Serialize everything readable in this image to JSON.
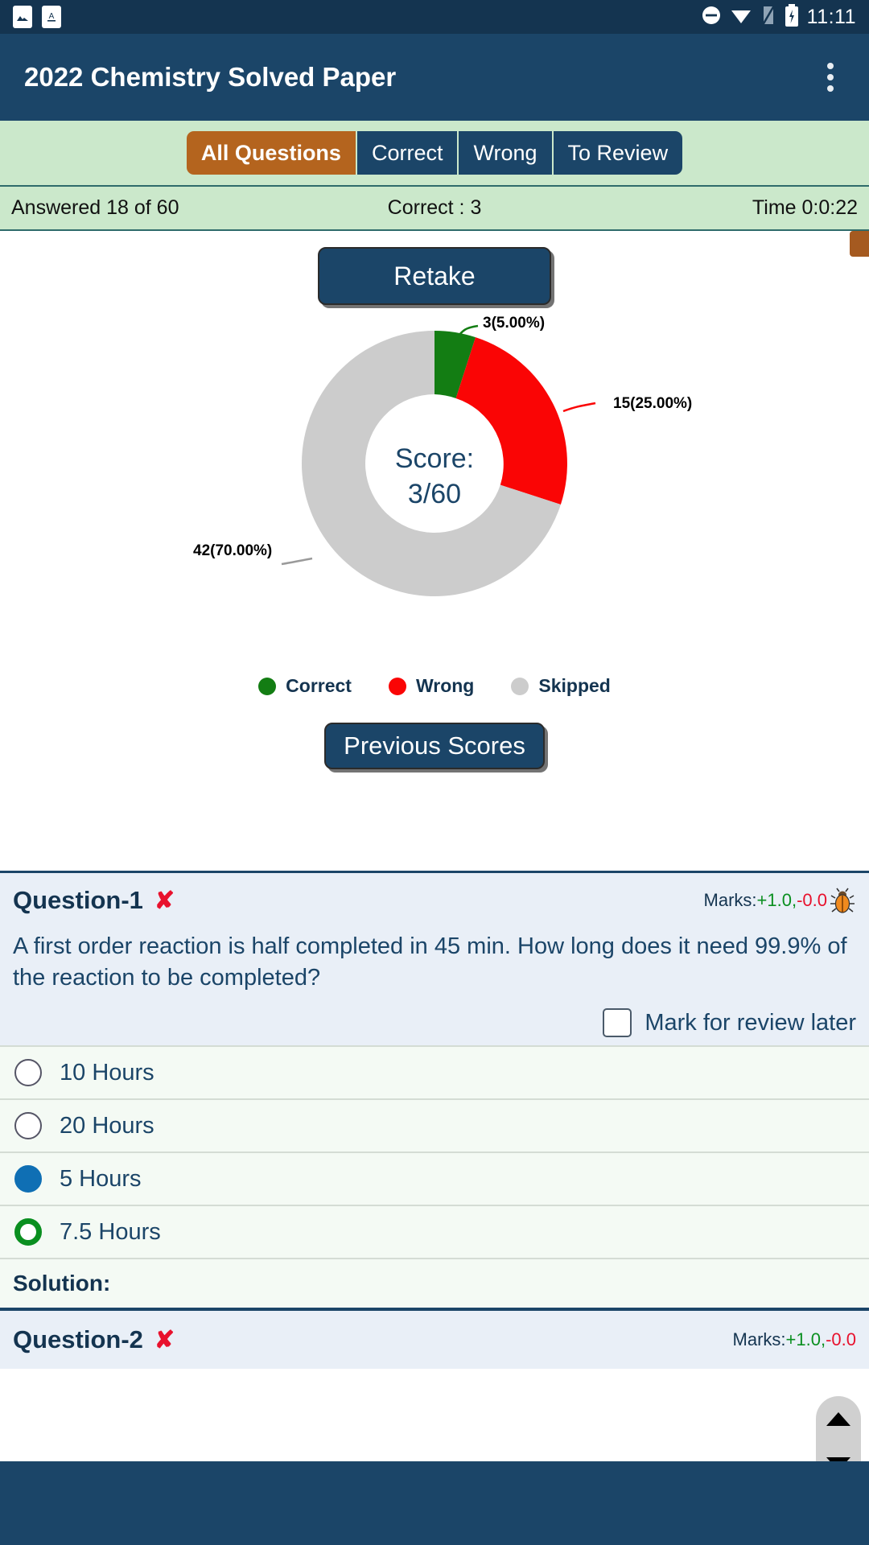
{
  "statusbar": {
    "notification_icons": [
      "image-icon",
      "font-size-icon"
    ],
    "right_icons": [
      "do-not-disturb-icon",
      "wifi-icon",
      "signal-icon",
      "battery-charging-icon"
    ],
    "clock": "11:11"
  },
  "appbar": {
    "title": "2022 Chemistry Solved Paper",
    "overflow_icon": "kebab-menu-icon"
  },
  "tabs": [
    {
      "label": "All Questions",
      "active": true
    },
    {
      "label": "Correct",
      "active": false
    },
    {
      "label": "Wrong",
      "active": false
    },
    {
      "label": "To Review",
      "active": false
    }
  ],
  "stats": {
    "answered": "Answered 18 of 60",
    "correct": "Correct : 3",
    "time": "Time 0:0:22"
  },
  "actions": {
    "retake_label": "Retake",
    "previous_scores_label": "Previous Scores"
  },
  "score": {
    "label": "Score:",
    "value": "3/60"
  },
  "chart_data": {
    "type": "pie",
    "title": "Score: 3/60",
    "categories": [
      "Correct",
      "Wrong",
      "Skipped"
    ],
    "values": [
      3,
      15,
      42
    ],
    "percents": [
      5.0,
      25.0,
      70.0
    ],
    "labels": [
      "3(5.00%)",
      "15(25.00%)",
      "42(70.00%)"
    ],
    "colors": [
      "#137d13",
      "#fa0505",
      "#cccccc"
    ],
    "total": 60,
    "donut": true,
    "inner_radius_ratio": 0.52,
    "legend_position": "bottom",
    "legend": [
      "Correct",
      "Wrong",
      "Skipped"
    ],
    "start_angle_deg": -90,
    "grid": false
  },
  "colors": {
    "brand_dark": "#1b4568",
    "status_dark": "#143450",
    "accent_orange": "#b4641e",
    "tabstrip_green": "#cbe8cb",
    "correct_green": "#137d13",
    "wrong_red": "#fa0505",
    "skipped_gray": "#cccccc",
    "selected_blue": "#0f6fb4",
    "card_blue": "#e9eff7",
    "option_bg": "#f4faf4"
  },
  "question1": {
    "title": "Question-1",
    "result_icon": "cross-mark-icon",
    "marks_prefix": "Marks:",
    "marks_positive": "+1.0,",
    "marks_negative": "-0.0",
    "bug_icon": "bug-report-icon",
    "text": "A first order reaction is half completed in 45 min. How long does it need 99.9% of the reaction to be completed?",
    "review_label": "Mark for review later",
    "review_checked": false,
    "options": [
      {
        "label": "10 Hours",
        "state": "none"
      },
      {
        "label": "20 Hours",
        "state": "none"
      },
      {
        "label": "5 Hours",
        "state": "selected"
      },
      {
        "label": "7.5 Hours",
        "state": "correct"
      }
    ],
    "solution_label": "Solution:"
  },
  "question2": {
    "title": "Question-2",
    "result_icon": "cross-mark-icon",
    "marks_prefix": "Marks:",
    "marks_positive": "+1.0,",
    "marks_negative": "-0.0"
  },
  "scroll_control": {
    "up_icon": "chevron-up-icon",
    "down_icon": "chevron-down-icon"
  }
}
